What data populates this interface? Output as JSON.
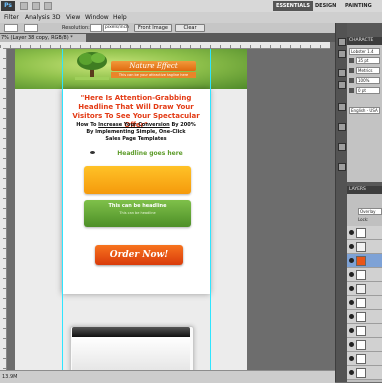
{
  "app": {
    "logo": "Ps",
    "workspaces": [
      "ESSENTIALS",
      "DESIGN",
      "PAINTING"
    ],
    "active_workspace": "ESSENTIALS"
  },
  "menu": [
    "Filter",
    "Analysis",
    "3D",
    "View",
    "Window",
    "Help"
  ],
  "options_bar": {
    "resolution_label": "Resolution:",
    "resolution_unit": "pixels/inch",
    "front_image_label": "Front Image",
    "clear_label": "Clear"
  },
  "document_tab": "7% (Layer 38 copy, RGB/8) *",
  "canvas": {
    "banner_title": "Nature Effect",
    "banner_subtitle": "This can be your attractive tagline here",
    "headline": "\"Here Is Attention-Grabbing Headline That Will Draw Your Visitors To See Your Spectacular Offer\"",
    "subhead_pre": "How To ",
    "subhead_link": "Increase Your Conversion",
    "subhead_post": " By 200%",
    "subhead_line2": "By Implementing Simple, One-Click",
    "subhead_line3": "Sales Page Templates",
    "headline_placeholder": "Headline goes here",
    "green_title": "This can be headline",
    "green_sub": "This can be headline",
    "order_button": "Order Now!"
  },
  "status": {
    "zoom": "13.9M"
  },
  "panels": {
    "character_tab": "CHARACTE",
    "font_family": "Lobster 1.4",
    "font_size": "35 pt",
    "leading": "Metrics",
    "scale": "100%",
    "baseline": "0 pt",
    "language": "English - USA",
    "layers_tab": "LAYERS",
    "blend_mode": "Overlay",
    "lock_label": "Lock:"
  },
  "colors": {
    "accent_orange": "#f59a0c",
    "accent_green": "#5d9c2a",
    "headline_red": "#e33a14",
    "order_orange": "#e9561a"
  }
}
